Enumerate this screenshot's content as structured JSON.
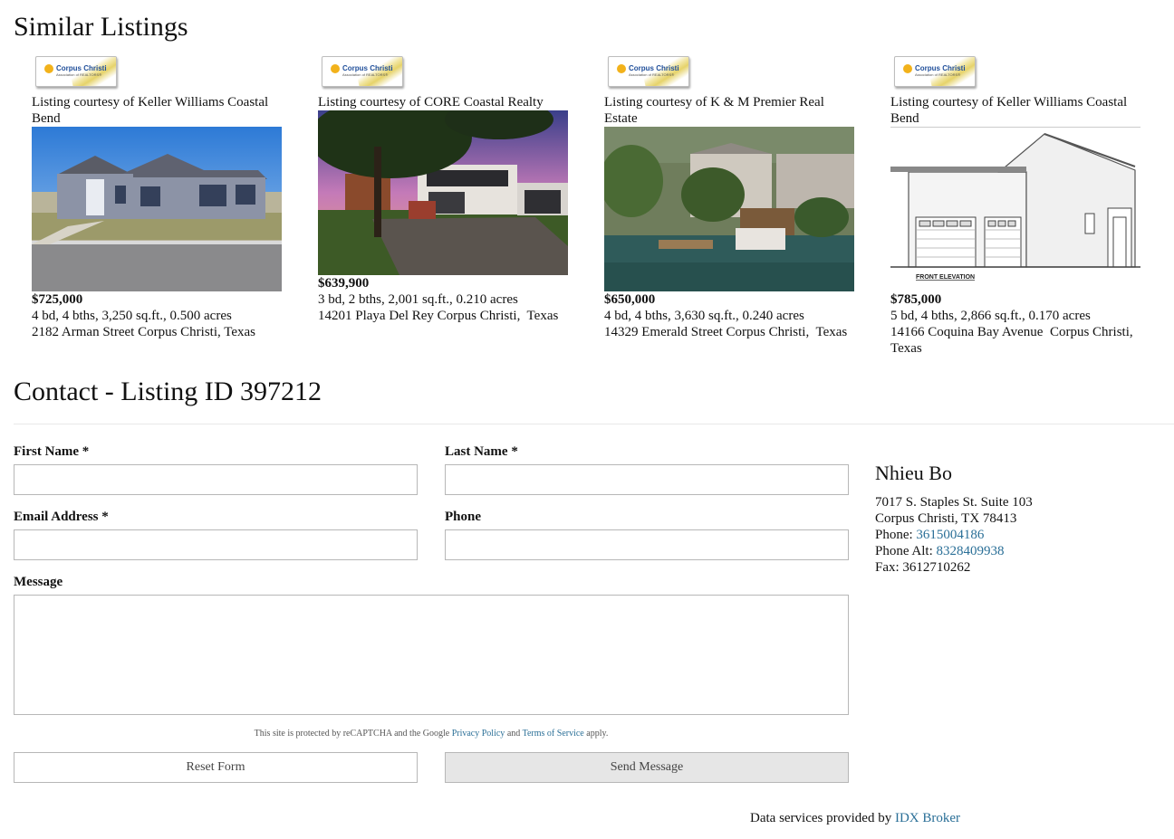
{
  "similar": {
    "title": "Similar Listings",
    "listings": [
      {
        "logo_name": "Corpus Christi",
        "logo_sub": "Association of REALTORS®",
        "courtesy": "Listing courtesy of Keller Williams Coastal Bend",
        "price": "$725,000",
        "details": "4 bd, 4 bths, 3,250 sq.ft., 0.500 acres",
        "address": "2182 Arman Street Corpus Christi, Texas"
      },
      {
        "logo_name": "Corpus Christi",
        "logo_sub": "Association of REALTORS®",
        "courtesy": "Listing courtesy of CORE Coastal Realty",
        "price": "$639,900",
        "details": "3 bd, 2 bths, 2,001 sq.ft., 0.210 acres",
        "address": "14201 Playa Del Rey Corpus Christi,  Texas"
      },
      {
        "logo_name": "Corpus Christi",
        "logo_sub": "Association of REALTORS®",
        "courtesy": "Listing courtesy of K & M Premier Real Estate",
        "price": "$650,000",
        "details": "4 bd, 4 bths, 3,630 sq.ft., 0.240 acres",
        "address": "14329 Emerald Street Corpus Christi,  Texas"
      },
      {
        "logo_name": "Corpus Christi",
        "logo_sub": "Association of REALTORS®",
        "courtesy": "Listing courtesy of Keller Williams Coastal Bend",
        "price": "$785,000",
        "details": "5 bd, 4 bths, 2,866 sq.ft., 0.170 acres",
        "address": "14166 Coquina Bay Avenue  Corpus Christi, Texas",
        "photo_caption": "FRONT ELEVATION"
      }
    ]
  },
  "contact": {
    "title": "Contact - Listing ID 397212",
    "first_name_label": "First Name *",
    "last_name_label": "Last Name *",
    "email_label": "Email Address *",
    "phone_label": "Phone",
    "message_label": "Message",
    "first_name_value": "",
    "last_name_value": "",
    "email_value": "",
    "phone_value": "",
    "message_value": "",
    "recaptcha_prefix": "This site is protected by reCAPTCHA and the Google ",
    "privacy_link": "Privacy Policy",
    "recaptcha_and": " and ",
    "terms_link": "Terms of Service",
    "recaptcha_suffix": " apply.",
    "reset_label": "Reset Form",
    "send_label": "Send Message"
  },
  "agent": {
    "name": "Nhieu Bo",
    "address1": "7017 S. Staples St. Suite 103",
    "address2": "Corpus Christi, TX 78413",
    "phone_label": "Phone: ",
    "phone": "3615004186",
    "phone_alt_label": "Phone Alt: ",
    "phone_alt": "8328409938",
    "fax_label": "Fax: ",
    "fax": "3612710262"
  },
  "footer": {
    "prefix": "Data services provided by ",
    "link": "IDX Broker"
  },
  "colors": {
    "link": "#2a6f97",
    "send_button_bg": "#e6e6e6"
  }
}
